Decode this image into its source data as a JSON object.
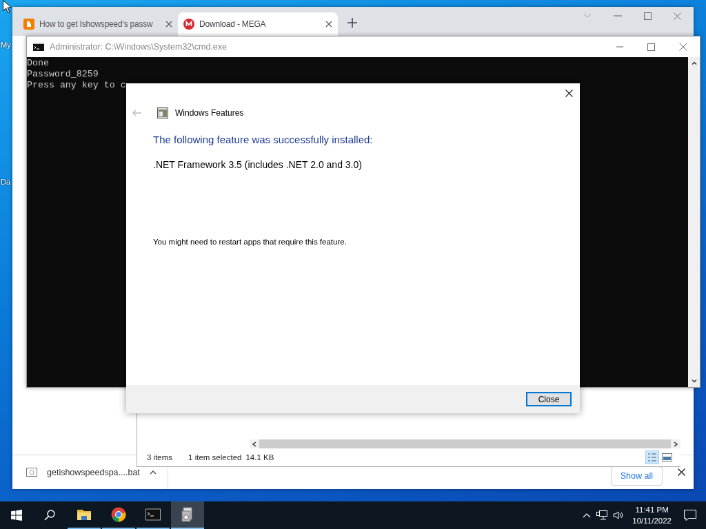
{
  "desktop": {
    "icons": [
      {
        "label": "My"
      },
      {
        "label": "Da"
      }
    ]
  },
  "browser": {
    "tabs": [
      {
        "title": "How to get Ishowspeed's passw",
        "selected": false,
        "kind": "blogger"
      },
      {
        "title": "Download - MEGA",
        "selected": true,
        "kind": "mega"
      }
    ],
    "download": {
      "file": "getishowspeedspa....bat",
      "button": "Show all"
    }
  },
  "explorer": {
    "status": [
      "3 items",
      "1 item selected",
      "14.1 KB"
    ]
  },
  "console": {
    "title": "Administrator: C:\\Windows\\System32\\cmd.exe",
    "lines": [
      "Done",
      "Password_8259",
      "Press any key to c"
    ]
  },
  "dialog": {
    "title": "Windows Features",
    "heading": "The following feature was successfully installed:",
    "feature": ".NET Framework 3.5 (includes .NET 2.0 and 3.0)",
    "note": "You might need to restart apps that require this feature.",
    "button": "Close"
  },
  "taskbar": {
    "apps": [
      {
        "kind": "explorer",
        "active": false
      },
      {
        "kind": "chrome",
        "active": false
      },
      {
        "kind": "cmd",
        "active": false
      },
      {
        "kind": "features",
        "active": true
      }
    ],
    "time": "11:41 PM",
    "date": "10/11/2022"
  }
}
